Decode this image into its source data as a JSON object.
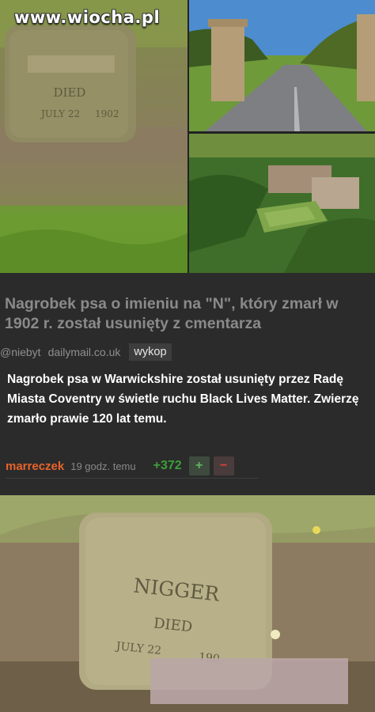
{
  "watermark": "www.wiocha.pl",
  "headline": "Nagrobek psa o imieniu na \"N\", który zmarł w 1902 r. został usunięty z cmentarza",
  "meta": {
    "author": "@niebyt",
    "source": "dailymail.co.uk",
    "tag": "wykop"
  },
  "body": "Nagrobek psa w Warwickshire został usunięty przez Radę Miasta Coventry w świetle ruchu Black Lives Matter. Zwierzę zmarło prawie 120 lat temu.",
  "footer": {
    "user": "marreczek",
    "time": "19 godz. temu",
    "score": "+372",
    "plus": "+",
    "minus": "−"
  },
  "gravestone_small": {
    "line1": "DIED",
    "line2": "JULY 22",
    "line3": "1902"
  },
  "gravestone_big": {
    "line1": "NIGGER",
    "line2": "DIED",
    "line3": "JULY 22",
    "line4": "190"
  },
  "colors": {
    "username": "#e8632b",
    "score": "#3aa03a",
    "minus": "#d8433a",
    "panel_bg": "#2b2b2b"
  }
}
